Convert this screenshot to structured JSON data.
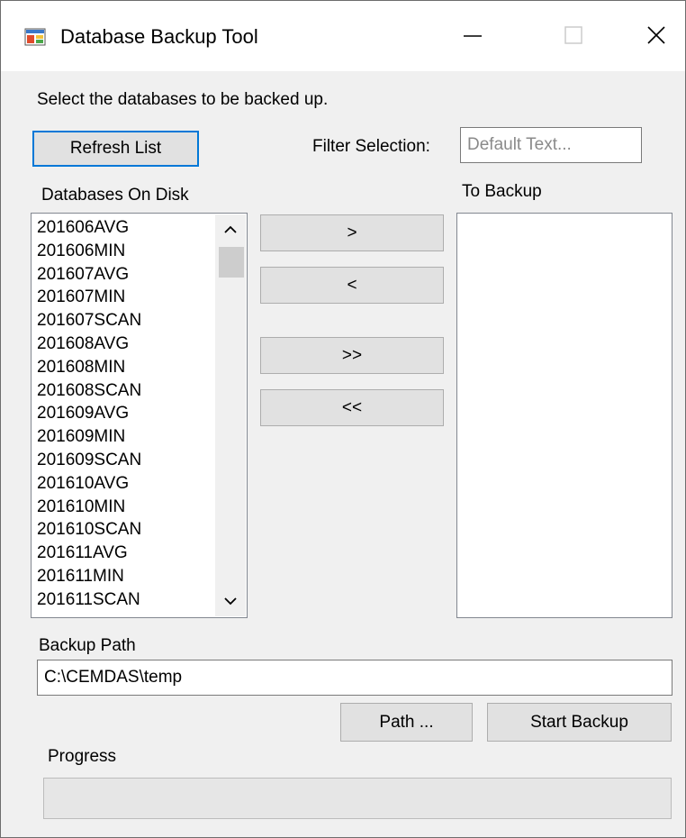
{
  "window": {
    "title": "Database Backup Tool"
  },
  "instructions": "Select the databases to be backed up.",
  "refresh_button": "Refresh List",
  "filter": {
    "label": "Filter Selection:",
    "placeholder": "Default Text..."
  },
  "databases_on_disk": {
    "label": "Databases On Disk",
    "items": [
      "201606AVG",
      "201606MIN",
      "201607AVG",
      "201607MIN",
      "201607SCAN",
      "201608AVG",
      "201608MIN",
      "201608SCAN",
      "201609AVG",
      "201609MIN",
      "201609SCAN",
      "201610AVG",
      "201610MIN",
      "201610SCAN",
      "201611AVG",
      "201611MIN",
      "201611SCAN"
    ]
  },
  "to_backup": {
    "label": "To Backup",
    "items": []
  },
  "transfer_buttons": {
    "add": ">",
    "remove": "<",
    "add_all": ">>",
    "remove_all": "<<"
  },
  "backup_path": {
    "label": "Backup Path",
    "value": "C:\\CEMDAS\\temp"
  },
  "path_button": "Path ...",
  "start_button": "Start Backup",
  "progress": {
    "label": "Progress",
    "fraction": 0
  },
  "colors": {
    "accent": "#0078d7",
    "window_bg": "#f0f0f0",
    "button_bg": "#e1e1e1"
  },
  "icons": {
    "app": "database-app-icon",
    "minimize": "minimize-icon",
    "maximize": "maximize-icon",
    "close": "close-icon"
  }
}
